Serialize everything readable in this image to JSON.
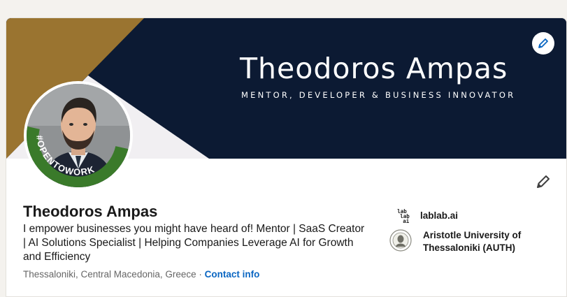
{
  "banner": {
    "title": "Theodoros Ampas",
    "subtitle": "MENTOR, DEVELOPER & BUSINESS INNOVATOR",
    "edit_icon": "pencil-icon"
  },
  "avatar": {
    "badge_text": "#OPENTOWORK",
    "badge_color": "#3a7a2a"
  },
  "profile": {
    "name": "Theodoros Ampas",
    "headline": "I empower businesses you might have heard of! Mentor | SaaS Creator | AI Solutions Specialist | Helping Companies Leverage AI for Growth and Efficiency",
    "location": "Thessaloniki, Central Macedonia, Greece",
    "separator": "·",
    "contact_label": "Contact info",
    "edit_icon": "pencil-icon"
  },
  "organizations": [
    {
      "name": "lablab.ai",
      "logo_lines": [
        "lab",
        "lab",
        "ai"
      ],
      "icon": "lablab-logo-icon"
    },
    {
      "name": "Aristotle University of Thessaloniki (AUTH)",
      "icon": "university-seal-icon"
    }
  ],
  "colors": {
    "banner_navy": "#0c1a33",
    "banner_gold": "#9a7430",
    "link_blue": "#0a66c2",
    "opentowork_green": "#3a7a2a"
  }
}
